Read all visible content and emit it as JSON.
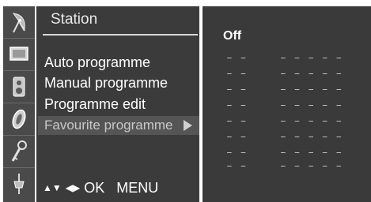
{
  "menu": {
    "title": "Station",
    "items": [
      {
        "label": "Auto programme"
      },
      {
        "label": "Manual programme"
      },
      {
        "label": "Programme edit"
      },
      {
        "label": "Favourite programme",
        "selected": true
      }
    ],
    "footer": {
      "updown_symbol": "▲▼",
      "leftright_symbol": "◀▶",
      "ok_label": "OK",
      "menu_label": "MENU"
    }
  },
  "sidebar": {
    "icons": [
      "satellite-dish-icon",
      "monitor-icon",
      "speaker-icon",
      "clock-icon",
      "key-icon",
      "plug-icon"
    ]
  },
  "favourites": {
    "status": "Off",
    "rows": [
      {
        "channel": "– –",
        "name": "– – – – –"
      },
      {
        "channel": "– –",
        "name": "– – – – –"
      },
      {
        "channel": "– –",
        "name": "– – – – –"
      },
      {
        "channel": "– –",
        "name": "– – – – –"
      },
      {
        "channel": "– –",
        "name": "– – – – –"
      },
      {
        "channel": "– –",
        "name": "– – – – –"
      },
      {
        "channel": "– –",
        "name": "– – – – –"
      },
      {
        "channel": "– –",
        "name": "– – – – –"
      }
    ]
  }
}
